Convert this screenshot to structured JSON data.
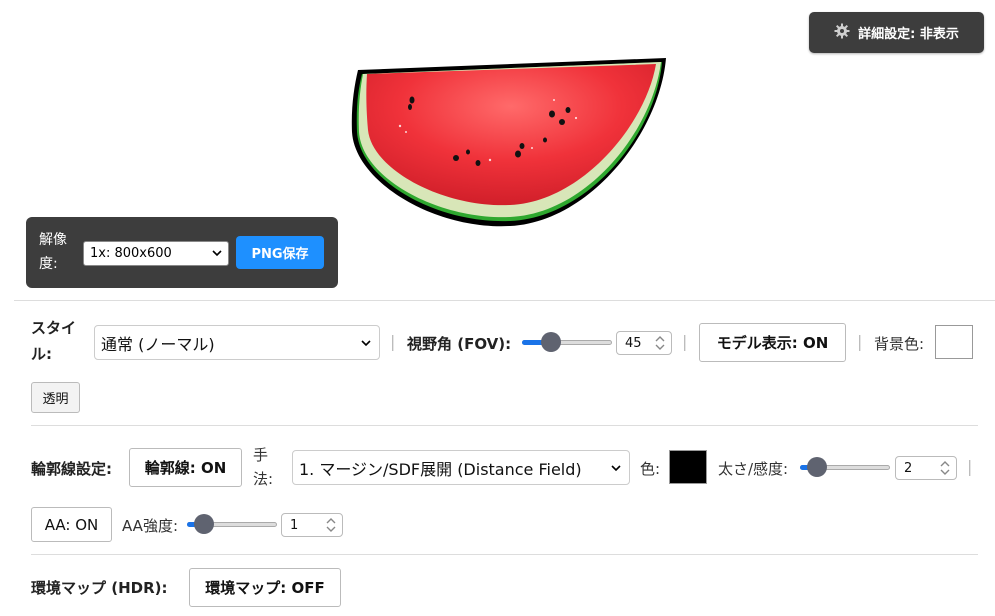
{
  "header": {
    "settings_button_label": "詳細設定: 非表示",
    "settings_icon": "gear-icon"
  },
  "resolution": {
    "label": "解像度:",
    "selected": "1x: 800x600",
    "save_button": "PNG保存"
  },
  "style_row": {
    "style_label": "スタイル:",
    "style_selected": "通常 (ノーマル)",
    "fov_label": "視野角 (FOV):",
    "fov_value": "45",
    "fov_fraction": 0.27,
    "model_button": "モデル表示: ON",
    "bg_label": "背景色:",
    "bg_color": "#ffffff",
    "transparent_button": "透明"
  },
  "outline_row": {
    "section_label": "輪郭線設定:",
    "outline_button": "輪郭線: ON",
    "method_label": "手法:",
    "method_selected": "1. マージン/SDF展開 (Distance Field)",
    "color_label": "色:",
    "outline_color": "#000000",
    "thickness_label": "太さ/感度:",
    "thickness_value": "2",
    "thickness_fraction": 0.1,
    "aa_button": "AA: ON",
    "aa_strength_label": "AA強度:",
    "aa_strength_value": "1",
    "aa_fraction": 0.1
  },
  "env_row": {
    "label": "環境マップ (HDR):",
    "button": "環境マップ: OFF"
  },
  "separator": "|",
  "colors": {
    "accent": "#1a73e8",
    "panel": "#3d3d3d",
    "png_button": "#1e90ff"
  }
}
